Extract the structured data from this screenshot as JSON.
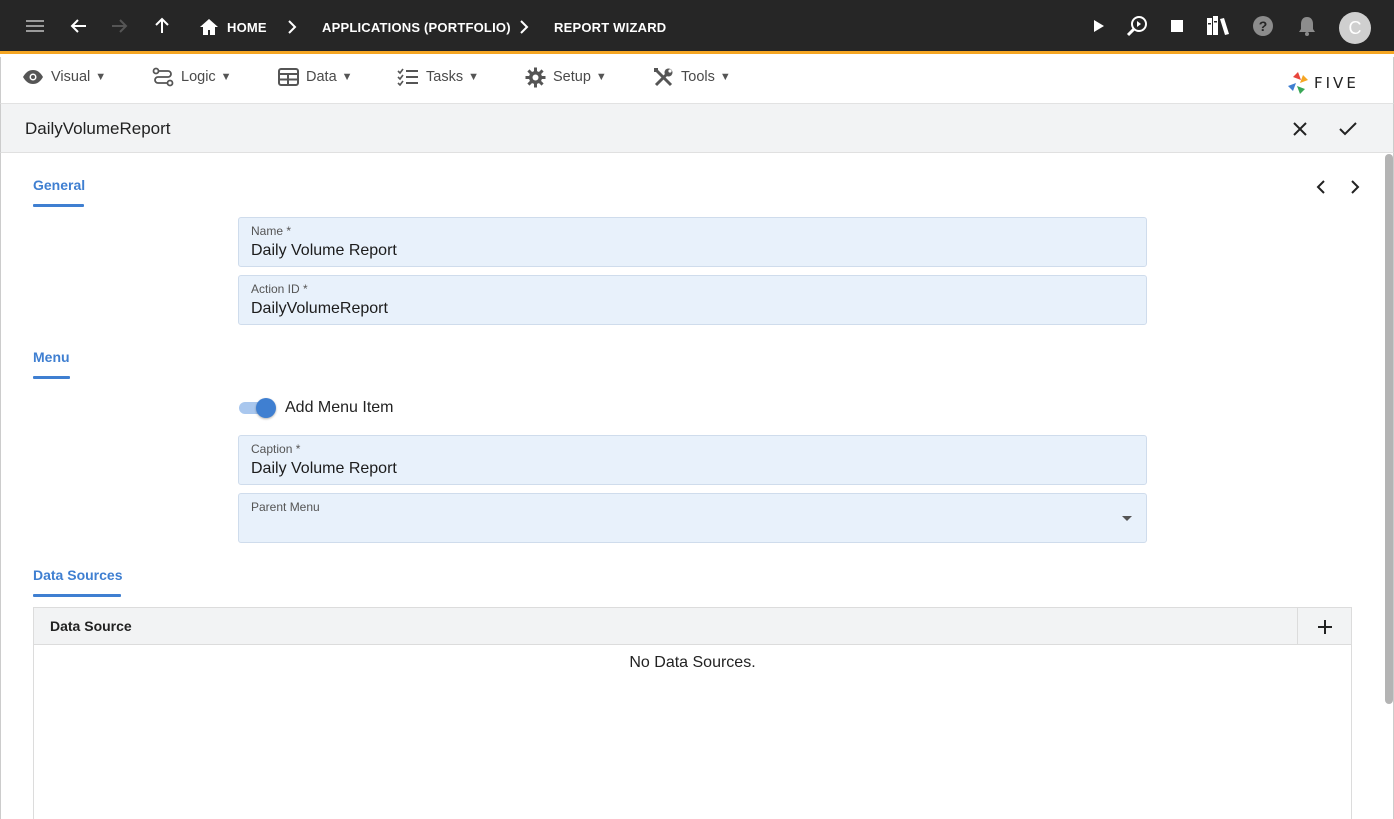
{
  "topbar": {
    "breadcrumbs": [
      "HOME",
      "APPLICATIONS (PORTFOLIO)",
      "REPORT WIZARD"
    ],
    "avatar_initial": "C",
    "icons": [
      "menu-icon",
      "back-arrow-icon",
      "forward-arrow-icon",
      "up-arrow-icon",
      "home-icon",
      "play-icon",
      "inspect-icon",
      "stop-icon",
      "library-icon",
      "help-icon",
      "bell-icon"
    ]
  },
  "menubar": {
    "items": [
      {
        "label": "Visual",
        "icon": "eye-icon"
      },
      {
        "label": "Logic",
        "icon": "logic-icon"
      },
      {
        "label": "Data",
        "icon": "table-icon"
      },
      {
        "label": "Tasks",
        "icon": "checklist-icon"
      },
      {
        "label": "Setup",
        "icon": "gear-icon"
      },
      {
        "label": "Tools",
        "icon": "tools-icon"
      }
    ],
    "caret": "▼",
    "logo_text": "FIVE"
  },
  "form": {
    "title": "DailyVolumeReport",
    "sections": {
      "general": "General",
      "menu": "Menu",
      "data_sources": "Data Sources"
    },
    "fields": {
      "name": {
        "label": "Name *",
        "value": "Daily Volume Report"
      },
      "action_id": {
        "label": "Action ID *",
        "value": "DailyVolumeReport"
      },
      "caption": {
        "label": "Caption *",
        "value": "Daily Volume Report"
      },
      "parent_menu": {
        "label": "Parent Menu",
        "value": ""
      }
    },
    "toggle": {
      "label": "Add Menu Item",
      "on": true
    },
    "grid": {
      "column": "Data Source",
      "empty_text": "No Data Sources."
    }
  },
  "colors": {
    "accent": "#3f7fd1",
    "topbar_bg": "#262626",
    "topbar_border": "#f5a623",
    "field_bg": "#e8f1fb"
  }
}
